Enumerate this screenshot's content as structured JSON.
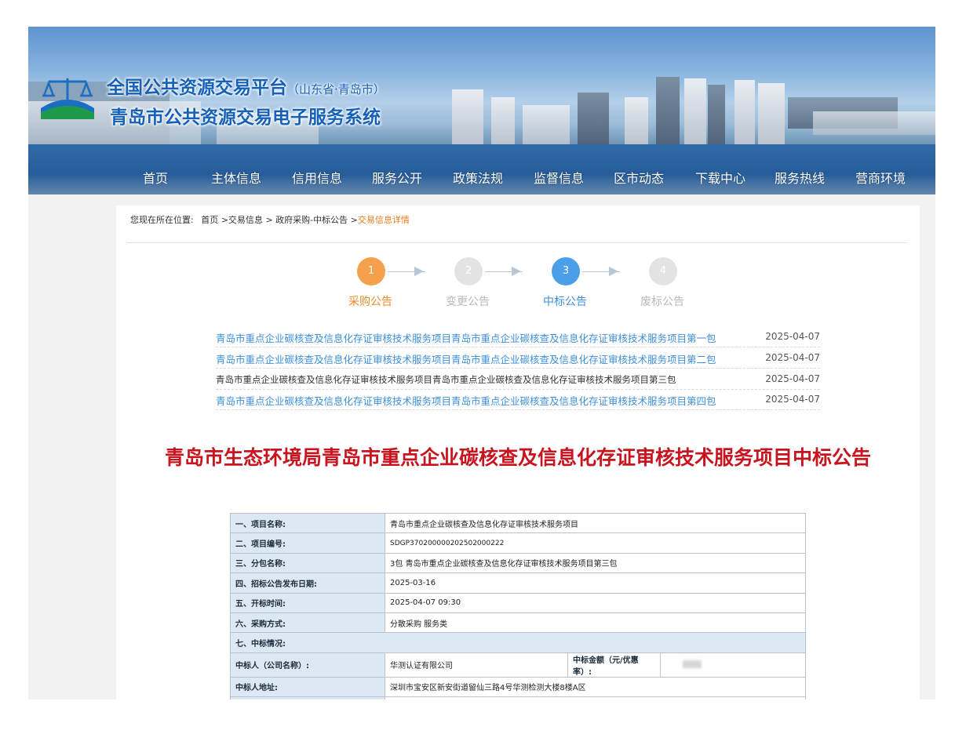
{
  "header": {
    "title_main": "全国公共资源交易平台",
    "title_sub": "（山东省·青岛市）",
    "system_title": "青岛市公共资源交易电子服务系统"
  },
  "nav": [
    "首页",
    "主体信息",
    "信用信息",
    "服务公开",
    "政策法规",
    "监督信息",
    "区市动态",
    "下载中心",
    "服务热线",
    "营商环境"
  ],
  "breadcrumb": {
    "prefix": "您现在所在位置:",
    "items": [
      "首页",
      ">交易信息",
      ">",
      "政府采购-中标公告",
      ">"
    ],
    "current": "交易信息详情"
  },
  "steps": [
    {
      "num": "1",
      "label": "采购公告",
      "state": "done",
      "color": "#f5a04a"
    },
    {
      "num": "2",
      "label": "变更公告",
      "state": "inactive",
      "color": "#e3e3e3"
    },
    {
      "num": "3",
      "label": "中标公告",
      "state": "active",
      "color": "#4b9ee8"
    },
    {
      "num": "4",
      "label": "废标公告",
      "state": "inactive",
      "color": "#e3e3e3"
    }
  ],
  "packages": [
    {
      "title": "青岛市重点企业碳核查及信息化存证审核技术服务项目青岛市重点企业碳核查及信息化存证审核技术服务项目第一包",
      "date": "2025-04-07",
      "link": true
    },
    {
      "title": "青岛市重点企业碳核查及信息化存证审核技术服务项目青岛市重点企业碳核查及信息化存证审核技术服务项目第二包",
      "date": "2025-04-07",
      "link": true
    },
    {
      "title": "青岛市重点企业碳核查及信息化存证审核技术服务项目青岛市重点企业碳核查及信息化存证审核技术服务项目第三包",
      "date": "2025-04-07",
      "link": false
    },
    {
      "title": "青岛市重点企业碳核查及信息化存证审核技术服务项目青岛市重点企业碳核查及信息化存证审核技术服务项目第四包",
      "date": "2025-04-07",
      "link": true
    }
  ],
  "notice_title": "青岛市生态环境局青岛市重点企业碳核查及信息化存证审核技术服务项目中标公告",
  "info": {
    "project_name_label": "一、项目名称:",
    "project_name": "青岛市重点企业碳核查及信息化存证审核技术服务项目",
    "project_no_label": "二、项目编号:",
    "project_no": "SDGP370200000202502000222",
    "package_label": "三、分包名称:",
    "package_name": "3包 青岛市重点企业碳核查及信息化存证审核技术服务项目第三包",
    "publish_date_label": "四、招标公告发布日期:",
    "publish_date": "2025-03-16",
    "open_time_label": "五、开标时间:",
    "open_time": "2025-04-07 09:30",
    "method_label": "六、采购方式:",
    "method": "分散采购 服务类",
    "result_label": "七、中标情况:",
    "winner_label": "中标人（公司名称）:",
    "winner": "华测认证有限公司",
    "amount_label": "中标金额（元/优惠率）:",
    "address_label": "中标人地址:",
    "address": "深圳市宝安区新安街道留仙三路4号华测检测大楼8楼A区"
  }
}
